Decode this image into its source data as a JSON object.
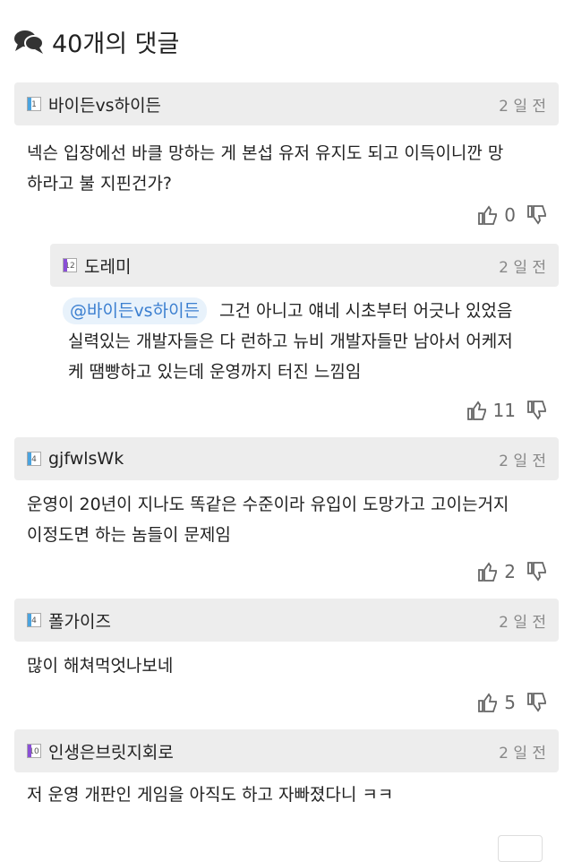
{
  "header": {
    "title": "40개의 댓글",
    "icon": "comments-icon"
  },
  "comments": [
    {
      "level": "1",
      "level_color": "#4aa3df",
      "nickname": "바이든vs하이든",
      "time": "2 일 전",
      "text_lines": [
        "넥슨 입장에선 바클 망하는 게 본섭 유저 유지도 되고 이득이니깐 망",
        "하라고 불 지핀건가?"
      ],
      "likes": "0"
    },
    {
      "level": "12",
      "level_color": "#8a4fd6",
      "nickname": "도레미",
      "time": "2 일 전",
      "reply": true,
      "mention": "@바이든vs하이든",
      "text_lines": [
        "그건 아니고 얘네 시초부터 어긋나 있었음",
        "실력있는 개발자들은 다 런하고 뉴비 개발자들만 남아서 어케저",
        "케 땜빵하고 있는데 운영까지 터진 느낌임"
      ],
      "likes": "11"
    },
    {
      "level": "4",
      "level_color": "#4aa3df",
      "nickname": "gjfwlsWk",
      "time": "2 일 전",
      "text_lines": [
        "운영이 20년이 지나도 똑같은 수준이라 유입이 도망가고 고이는거지",
        "이정도면 하는 놈들이 문제임"
      ],
      "likes": "2"
    },
    {
      "level": "4",
      "level_color": "#4aa3df",
      "nickname": "폴가이즈",
      "time": "2 일 전",
      "text_lines": [
        "많이 해쳐먹엇나보네"
      ],
      "likes": "5"
    },
    {
      "level": "10",
      "level_color": "#8a4fd6",
      "nickname": "인생은브릿지회로",
      "time": "2 일 전",
      "text_lines": [
        "저 운영 개판인 게임을 아직도 하고 자빠졌다니 ㅋㅋ"
      ]
    }
  ]
}
